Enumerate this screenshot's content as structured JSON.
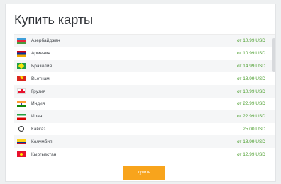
{
  "modal": {
    "title": "Купить карты",
    "buy_button_label": "купить"
  },
  "countries": [
    {
      "name": "Азербайджан",
      "price": "от 10.99 USD",
      "flag": "az"
    },
    {
      "name": "Армения",
      "price": "от 10.99 USD",
      "flag": "am"
    },
    {
      "name": "Бразилия",
      "price": "от 14.99 USD",
      "flag": "br"
    },
    {
      "name": "Вьетнам",
      "price": "от 18.99 USD",
      "flag": "vn"
    },
    {
      "name": "Грузия",
      "price": "от 10.99 USD",
      "flag": "ge"
    },
    {
      "name": "Индия",
      "price": "от 22.99 USD",
      "flag": "in"
    },
    {
      "name": "Иран",
      "price": "от 22.99 USD",
      "flag": "ir"
    },
    {
      "name": "Кавказ",
      "price": "25.00 USD",
      "flag": "cc"
    },
    {
      "name": "Колумбия",
      "price": "от 18.99 USD",
      "flag": "co"
    },
    {
      "name": "Кыргызстан",
      "price": "от 12.99 USD",
      "flag": "kg"
    }
  ],
  "colors": {
    "price_green": "#4c9f2f",
    "button_orange": "#f8a41c"
  }
}
